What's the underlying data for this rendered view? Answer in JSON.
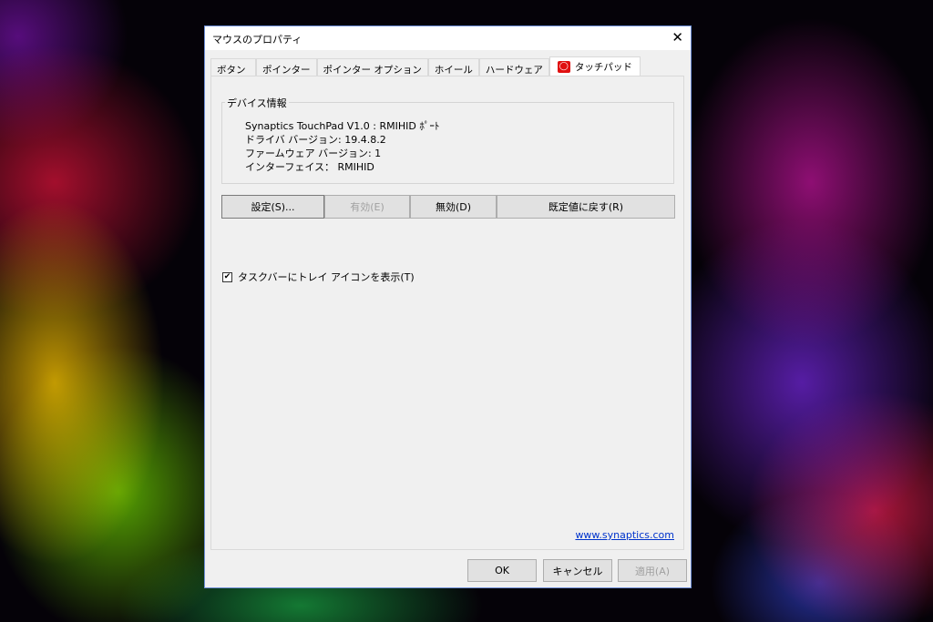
{
  "window": {
    "title": "マウスのプロパティ",
    "close": "✕"
  },
  "tabs": [
    "ボタン",
    "ポインター",
    "ポインター オプション",
    "ホイール",
    "ハードウェア",
    "タッチパッド"
  ],
  "device_info": {
    "label": "デバイス情報",
    "lines": [
      "Synaptics TouchPad V1.0 : RMIHID ﾎﾟｰﾄ",
      "ドライバ バージョン: 19.4.8.2",
      "ファームウェア バージョン: 1",
      "インターフェイス： RMIHID"
    ]
  },
  "buttons": {
    "settings": "設定(S)...",
    "enable": "有効(E)",
    "disable": "無効(D)",
    "restore": "既定値に戻す(R)"
  },
  "checkbox": {
    "label": "タスクバーにトレイ アイコンを表示(T)",
    "checked": true,
    "mark": "✔"
  },
  "link": "www.synaptics.com",
  "footer": {
    "ok": "OK",
    "cancel": "キャンセル",
    "apply": "適用(A)"
  }
}
